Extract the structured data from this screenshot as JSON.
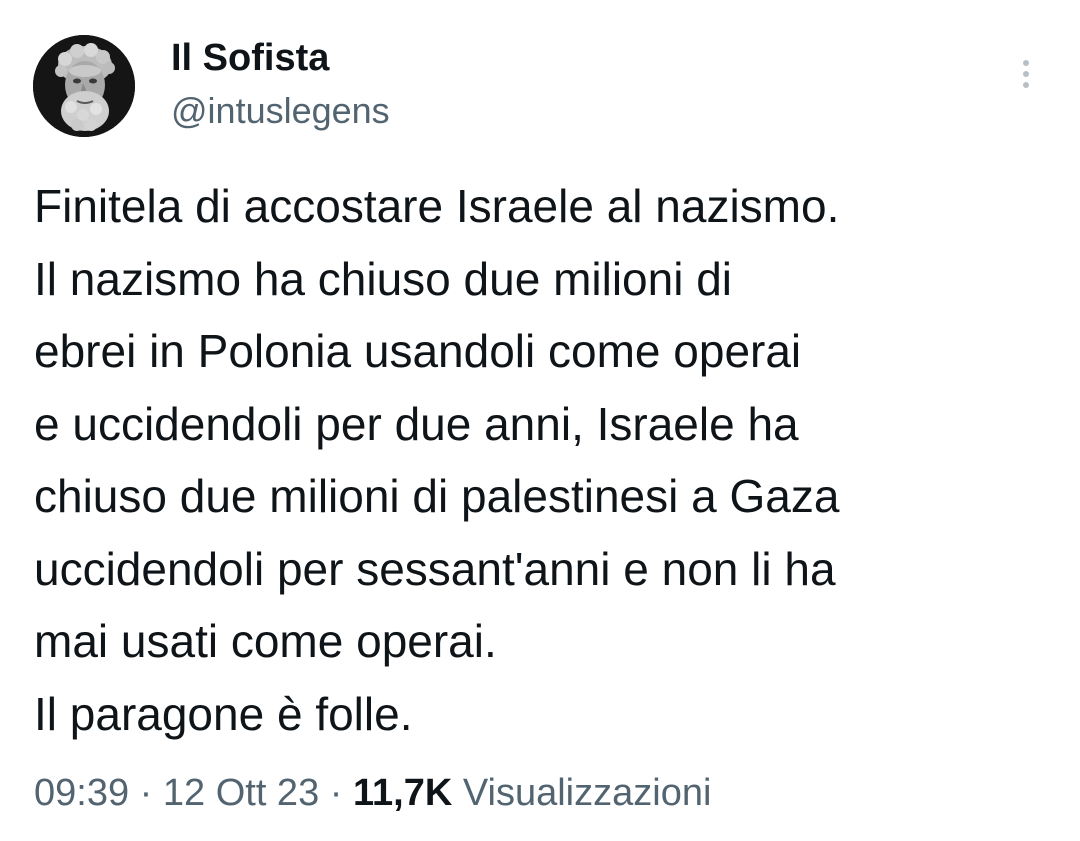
{
  "author": {
    "display_name": "Il Sofista",
    "handle": "@intuslegens",
    "avatar_icon": "philosopher-bust-avatar"
  },
  "menu": {
    "icon": "more-vertical-icon"
  },
  "tweet": {
    "lines": [
      "Finitela di accostare Israele al nazismo.",
      "Il nazismo ha chiuso due milioni di",
      "ebrei in Polonia usandoli come operai",
      "e uccidendoli per due anni, Israele ha",
      "chiuso due milioni di palestinesi a Gaza",
      "uccidendoli per sessant'anni e non li ha",
      "mai usati come operai.",
      "Il paragone è folle."
    ]
  },
  "meta": {
    "time": "09:39",
    "separator": "·",
    "date": "12 Ott 23",
    "views_count": "11,7K",
    "views_label": "Visualizzazioni"
  },
  "colors": {
    "text_primary": "#0f1419",
    "text_secondary": "#536471",
    "background": "#ffffff"
  }
}
